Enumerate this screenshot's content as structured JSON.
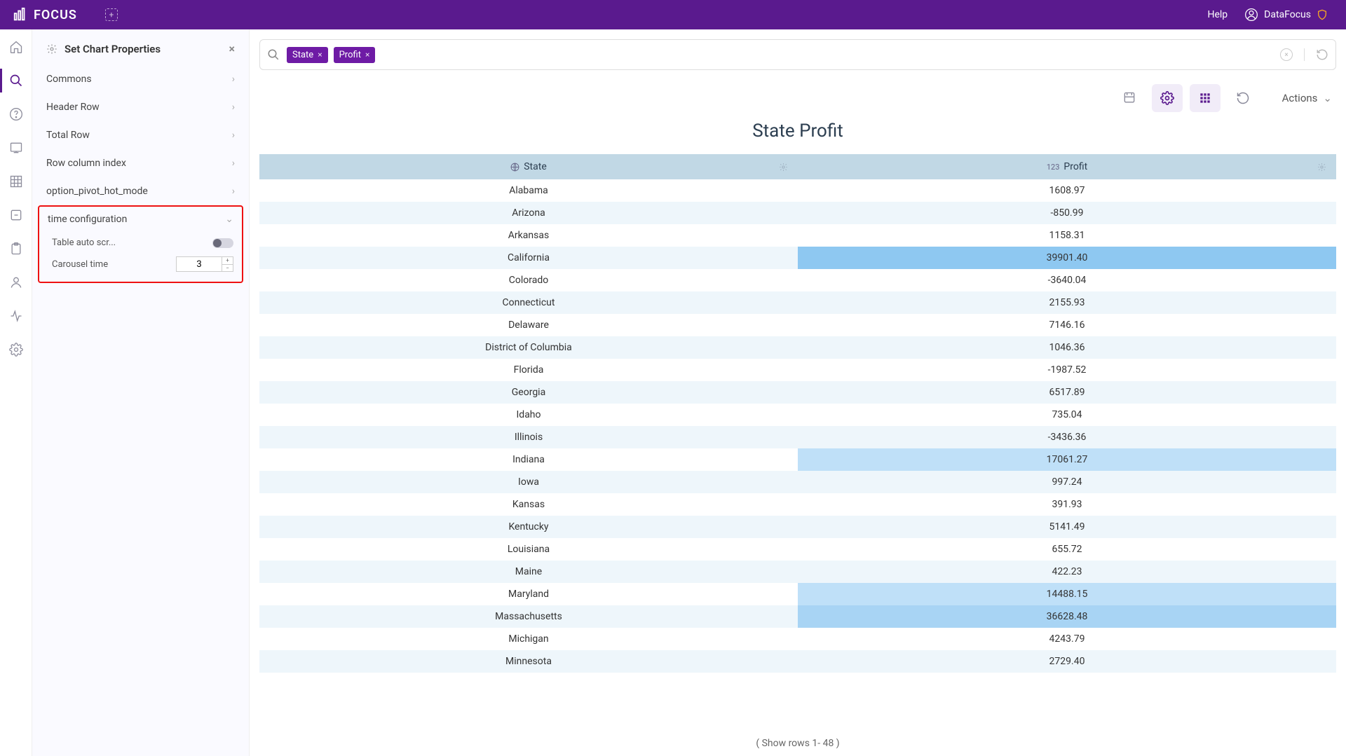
{
  "header": {
    "brand": "FOCUS",
    "help": "Help",
    "user": "DataFocus"
  },
  "panel": {
    "title": "Set Chart Properties",
    "sections": [
      "Commons",
      "Header Row",
      "Total Row",
      "Row column index",
      "option_pivot_hot_mode"
    ],
    "time_section": "time configuration",
    "auto_scroll_label": "Table auto scr...",
    "carousel_label": "Carousel time",
    "carousel_value": "3"
  },
  "search": {
    "chips": [
      "State",
      "Profit"
    ]
  },
  "toolbar": {
    "actions": "Actions"
  },
  "chart": {
    "title": "State Profit",
    "col1": "State",
    "col2": "Profit",
    "footer": "( Show rows 1- 48 )"
  },
  "rows": [
    {
      "state": "Alabama",
      "profit": "1608.97",
      "hl": 0
    },
    {
      "state": "Arizona",
      "profit": "-850.99",
      "hl": 0
    },
    {
      "state": "Arkansas",
      "profit": "1158.31",
      "hl": 0
    },
    {
      "state": "California",
      "profit": "39901.40",
      "hl": 3
    },
    {
      "state": "Colorado",
      "profit": "-3640.04",
      "hl": 0
    },
    {
      "state": "Connecticut",
      "profit": "2155.93",
      "hl": 0
    },
    {
      "state": "Delaware",
      "profit": "7146.16",
      "hl": 0
    },
    {
      "state": "District of Columbia",
      "profit": "1046.36",
      "hl": 0
    },
    {
      "state": "Florida",
      "profit": "-1987.52",
      "hl": 0
    },
    {
      "state": "Georgia",
      "profit": "6517.89",
      "hl": 0
    },
    {
      "state": "Idaho",
      "profit": "735.04",
      "hl": 0
    },
    {
      "state": "Illinois",
      "profit": "-3436.36",
      "hl": 0
    },
    {
      "state": "Indiana",
      "profit": "17061.27",
      "hl": 1
    },
    {
      "state": "Iowa",
      "profit": "997.24",
      "hl": 0
    },
    {
      "state": "Kansas",
      "profit": "391.93",
      "hl": 0
    },
    {
      "state": "Kentucky",
      "profit": "5141.49",
      "hl": 0
    },
    {
      "state": "Louisiana",
      "profit": "655.72",
      "hl": 0
    },
    {
      "state": "Maine",
      "profit": "422.23",
      "hl": 0
    },
    {
      "state": "Maryland",
      "profit": "14488.15",
      "hl": 1
    },
    {
      "state": "Massachusetts",
      "profit": "36628.48",
      "hl": 2
    },
    {
      "state": "Michigan",
      "profit": "4243.79",
      "hl": 0
    },
    {
      "state": "Minnesota",
      "profit": "2729.40",
      "hl": 0
    }
  ],
  "chart_data": {
    "type": "table",
    "title": "State Profit",
    "columns": [
      "State",
      "Profit"
    ],
    "rows": [
      [
        "Alabama",
        1608.97
      ],
      [
        "Arizona",
        -850.99
      ],
      [
        "Arkansas",
        1158.31
      ],
      [
        "California",
        39901.4
      ],
      [
        "Colorado",
        -3640.04
      ],
      [
        "Connecticut",
        2155.93
      ],
      [
        "Delaware",
        7146.16
      ],
      [
        "District of Columbia",
        1046.36
      ],
      [
        "Florida",
        -1987.52
      ],
      [
        "Georgia",
        6517.89
      ],
      [
        "Idaho",
        735.04
      ],
      [
        "Illinois",
        -3436.36
      ],
      [
        "Indiana",
        17061.27
      ],
      [
        "Iowa",
        997.24
      ],
      [
        "Kansas",
        391.93
      ],
      [
        "Kentucky",
        5141.49
      ],
      [
        "Louisiana",
        655.72
      ],
      [
        "Maine",
        422.23
      ],
      [
        "Maryland",
        14488.15
      ],
      [
        "Massachusetts",
        36628.48
      ],
      [
        "Michigan",
        4243.79
      ],
      [
        "Minnesota",
        2729.4
      ]
    ]
  }
}
